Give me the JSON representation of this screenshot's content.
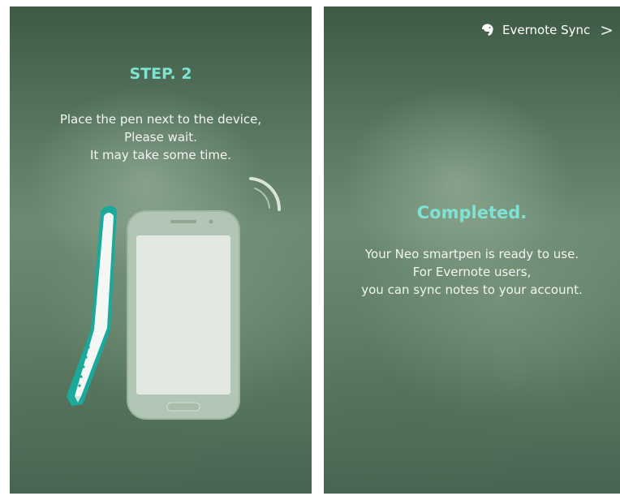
{
  "step_screen": {
    "title": "STEP. 2",
    "instructions": [
      "Place the pen next to the device,",
      "Please wait.",
      "It may take some time."
    ]
  },
  "completed_screen": {
    "evernote_sync": {
      "icon": "evernote-elephant-icon",
      "label": "Evernote Sync",
      "chevron": ">"
    },
    "title": "Completed.",
    "message": [
      "Your Neo smartpen is ready to use.",
      "For Evernote users,",
      "you can sync notes to your account."
    ]
  },
  "colors": {
    "accent": "#7fe3d4",
    "pen_stripe": "#1aa99a",
    "background": "#5e7c64"
  }
}
